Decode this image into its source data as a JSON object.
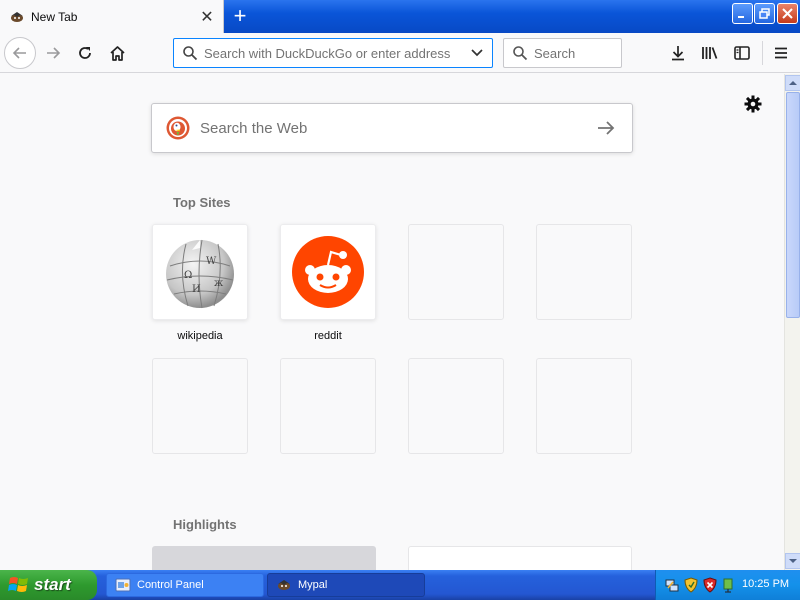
{
  "browser": {
    "tab_title": "New Tab",
    "urlbar_placeholder": "Search with DuckDuckGo or enter address",
    "searchbar_placeholder": "Search"
  },
  "newtab": {
    "search_placeholder": "Search the Web",
    "top_sites_heading": "Top Sites",
    "highlights_heading": "Highlights",
    "top_sites": [
      {
        "label": "wikipedia",
        "icon": "wikipedia-globe-icon"
      },
      {
        "label": "reddit",
        "icon": "reddit-alien-icon"
      }
    ]
  },
  "taskbar": {
    "start_label": "start",
    "tasks": [
      {
        "label": "Control Panel",
        "icon": "control-panel-icon",
        "active": false
      },
      {
        "label": "Mypal",
        "icon": "mypal-icon",
        "active": true
      }
    ],
    "clock": "10:25 PM"
  },
  "colors": {
    "accent": "#0a84ff",
    "reddit": "#ff4500",
    "ddg": "#de5833",
    "xp_blue": "#245edb",
    "xp_green": "#3c9f3c"
  }
}
